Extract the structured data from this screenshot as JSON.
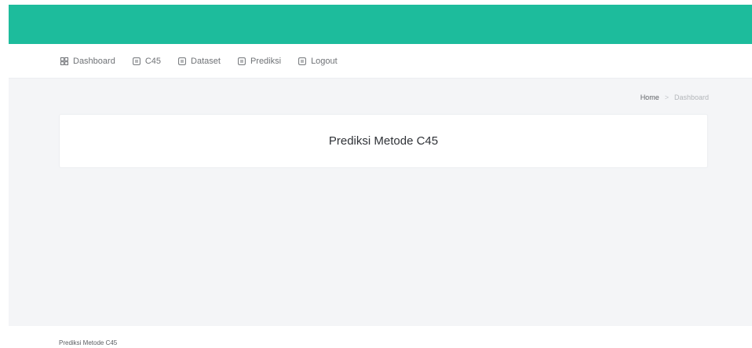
{
  "nav": {
    "items": [
      {
        "label": "Dashboard",
        "icon": "grid-icon"
      },
      {
        "label": "C45",
        "icon": "document-icon"
      },
      {
        "label": "Dataset",
        "icon": "document-icon"
      },
      {
        "label": "Prediksi",
        "icon": "document-icon"
      },
      {
        "label": "Logout",
        "icon": "document-icon"
      }
    ]
  },
  "breadcrumb": {
    "home": "Home",
    "separator": ">",
    "current": "Dashboard"
  },
  "main": {
    "card_title": "Prediksi Metode C45"
  },
  "footer": {
    "text": "Prediksi Metode C45"
  },
  "colors": {
    "header": "#1dbc9c",
    "content_background": "#f4f5f7"
  }
}
